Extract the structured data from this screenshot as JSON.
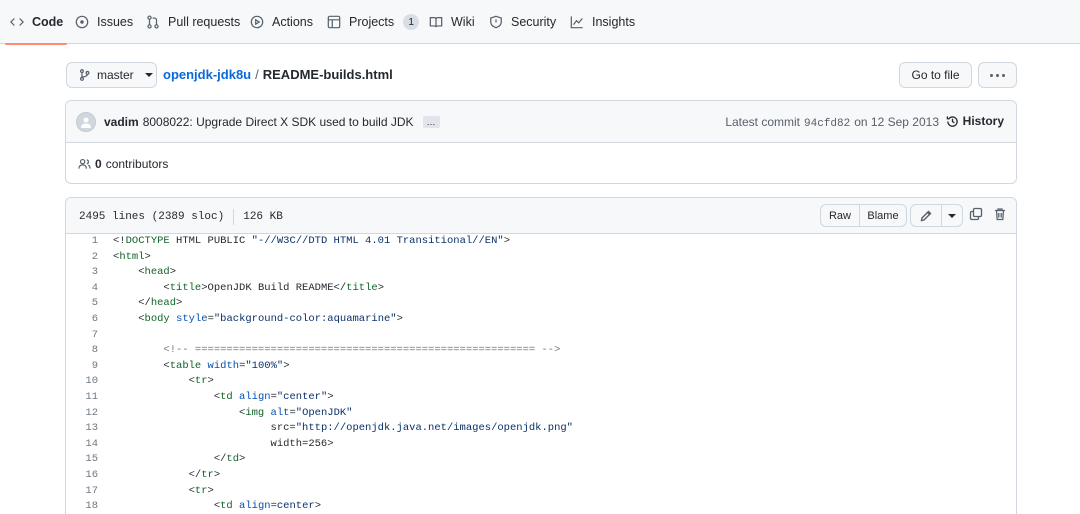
{
  "tabs": [
    {
      "label": "Code",
      "icon": "code-icon",
      "selected": true
    },
    {
      "label": "Issues",
      "icon": "issue-icon"
    },
    {
      "label": "Pull requests",
      "icon": "pull-request-icon"
    },
    {
      "label": "Actions",
      "icon": "play-icon"
    },
    {
      "label": "Projects",
      "icon": "table-icon",
      "counter": "1"
    },
    {
      "label": "Wiki",
      "icon": "book-icon"
    },
    {
      "label": "Security",
      "icon": "shield-icon"
    },
    {
      "label": "Insights",
      "icon": "graph-icon"
    }
  ],
  "breadcrumb": {
    "branch": "master",
    "repo": "openjdk-jdk8u",
    "separator": "/",
    "file": "README-builds.html",
    "goto_label": "Go to file"
  },
  "commit": {
    "author": "vadim",
    "message": "8008022: Upgrade Direct X SDK used to build JDK",
    "ellipsis": "…",
    "latest_label": "Latest commit",
    "sha": "94cfd82",
    "date_text": "on 12 Sep 2013",
    "history_label": "History",
    "contributors_count": "0",
    "contributors_label": "contributors"
  },
  "file": {
    "lines_info": "2495 lines (2389 sloc)",
    "size": "126 KB",
    "raw_label": "Raw",
    "blame_label": "Blame"
  },
  "code_lines": [
    {
      "n": "1",
      "text": "<!DOCTYPE HTML PUBLIC \"-//W3C//DTD HTML 4.01 Transitional//EN\">"
    },
    {
      "n": "2",
      "text": "<html>"
    },
    {
      "n": "3",
      "text": "    <head>"
    },
    {
      "n": "4",
      "text": "        <title>OpenJDK Build README</title>"
    },
    {
      "n": "5",
      "text": "    </head>"
    },
    {
      "n": "6",
      "text": "    <body style=\"background-color:aquamarine\">"
    },
    {
      "n": "7",
      "text": ""
    },
    {
      "n": "8",
      "text": "        <!-- ====================================================== -->"
    },
    {
      "n": "9",
      "text": "        <table width=\"100%\">"
    },
    {
      "n": "10",
      "text": "            <tr>"
    },
    {
      "n": "11",
      "text": "                <td align=\"center\">"
    },
    {
      "n": "12",
      "text": "                    <img alt=\"OpenJDK\""
    },
    {
      "n": "13",
      "text": "                         src=\"http://openjdk.java.net/images/openjdk.png\""
    },
    {
      "n": "14",
      "text": "                         width=256>"
    },
    {
      "n": "15",
      "text": "                </td>"
    },
    {
      "n": "16",
      "text": "            </tr>"
    },
    {
      "n": "17",
      "text": "            <tr>"
    },
    {
      "n": "18",
      "text": "                <td align=center>"
    }
  ],
  "colors": {
    "accent_underline": "#fd8c73",
    "link": "#0969da",
    "border": "#d0d7de",
    "header_bg": "#f6f8fa",
    "tag": "#116329",
    "attr": "#0550ae",
    "string": "#0a3069",
    "comment": "#6e7781"
  }
}
